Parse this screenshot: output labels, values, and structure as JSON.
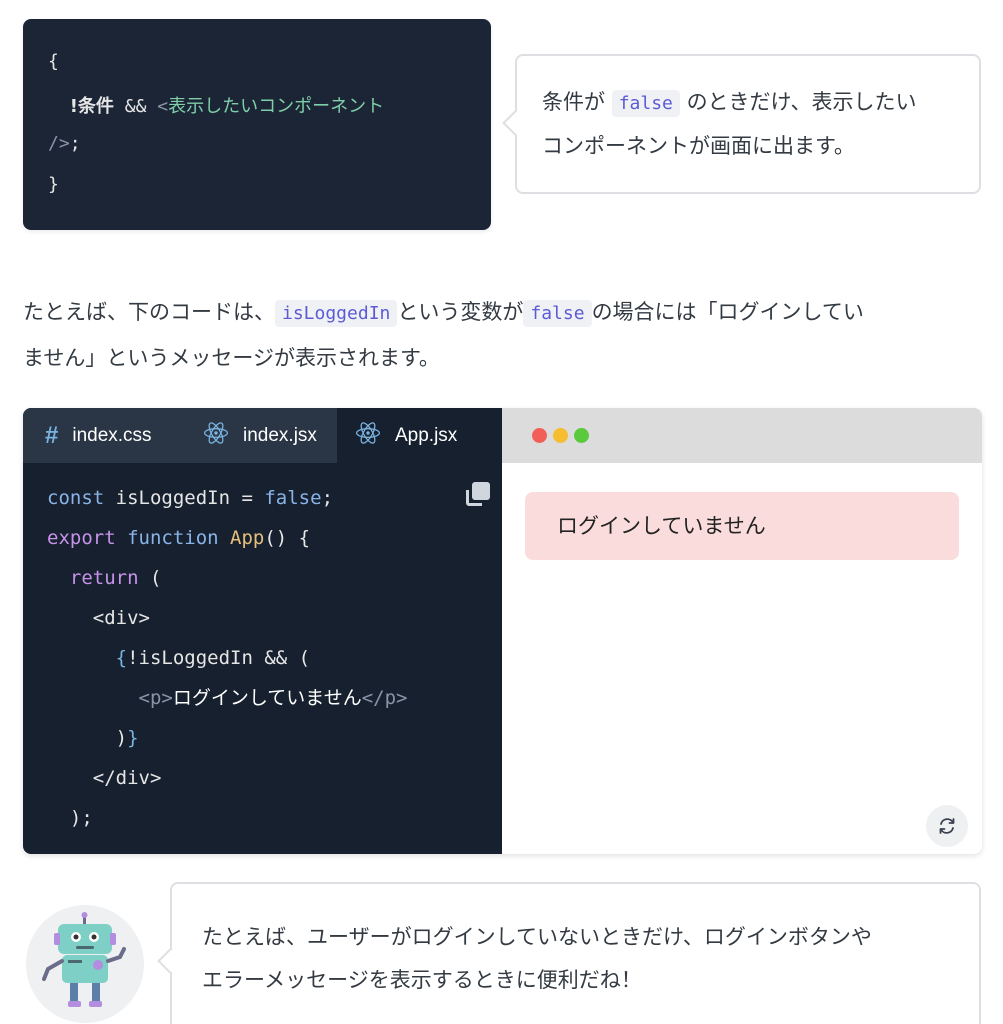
{
  "top_code": {
    "line1": "{",
    "line2_not": "!",
    "line2_cond": "条件",
    "line2_op": " && ",
    "line2_tag_open": "<",
    "line2_tag": "表示したいコンポーネント",
    "line3": "/>",
    "line3_semi": ";",
    "line4": "}"
  },
  "bubble1": {
    "text_before": "条件が",
    "code": "false",
    "text_after_line1": "のときだけ、表示したい",
    "text_line2": "コンポーネントが画面に出ます。"
  },
  "paragraph": {
    "part1": "たとえば、下のコードは、",
    "code1": "isLoggedIn",
    "part2": "という変数が",
    "code2": "false",
    "part3": "の場合には「ログインしてい",
    "part4": "ません」というメッセージが表示されます。"
  },
  "sandbox": {
    "tabs": [
      {
        "icon": "#",
        "label": "index.css"
      },
      {
        "icon": "react-atom",
        "label": "index.jsx"
      },
      {
        "icon": "react-atom",
        "label": "App.jsx"
      }
    ],
    "code": {
      "l1_kw": "const",
      "l1_rest": " isLoggedIn = ",
      "l1_val": "false",
      "l1_end": ";",
      "l2_kw": "export",
      "l2_kw2": " function",
      "l2_fn": " App",
      "l2_end": "() {",
      "l3_kw": "  return",
      "l3_end": " (",
      "l4": "    <div>",
      "l5_open": "      {",
      "l5_rest": "!isLoggedIn && (",
      "l6_indent": "        ",
      "l6_tag_open": "<p>",
      "l6_text": "ログインしていません",
      "l6_tag_close": "</p>",
      "l7_indent": "      ",
      "l7_paren": ")",
      "l7_brace": "}",
      "l8": "    </div>",
      "l9": "  );"
    },
    "preview_message": "ログインしていません",
    "dot_colors": [
      "#f25f58",
      "#f5bd2f",
      "#5ac93e"
    ]
  },
  "bubble2": {
    "line1": "たとえば、ユーザーがログインしていないときだけ、ログインボタンや",
    "line2": "エラーメッセージを表示するときに便利だね！"
  }
}
